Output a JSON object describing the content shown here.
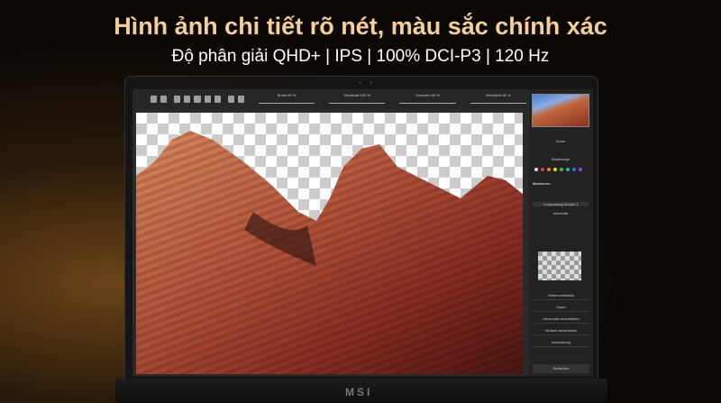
{
  "headline": "Hình ảnh chi tiết rõ nét, màu sắc chính xác",
  "subheadline": "Độ phân giải QHD+ | IPS | 100% DCI-P3 | 120 Hz",
  "brand_logo": "MSI",
  "toolbar": {
    "sliders": [
      {
        "label": "Breite 80 %"
      },
      {
        "label": "Deckkraft 100 %"
      },
      {
        "label": "Konturen 80 %"
      },
      {
        "label": "Weichheit 80 %"
      }
    ]
  },
  "panel": {
    "zoom": "Zoom",
    "brush": "Radierenge",
    "mask_title": "Maskieren",
    "mode": "Compositing Modus 1",
    "intensity": "Intensität",
    "sections": [
      "Seitenverhältnis",
      "Zoom",
      "Horizontal verschieben",
      "Vertikal verschieben",
      "Ausrichtung"
    ],
    "close": "Schließen",
    "colors": [
      "#dddddd",
      "#d9403a",
      "#e88a2a",
      "#e8d42a",
      "#4ab84a",
      "#2ab8a0",
      "#3a6ad8",
      "#8a4ad8"
    ]
  }
}
